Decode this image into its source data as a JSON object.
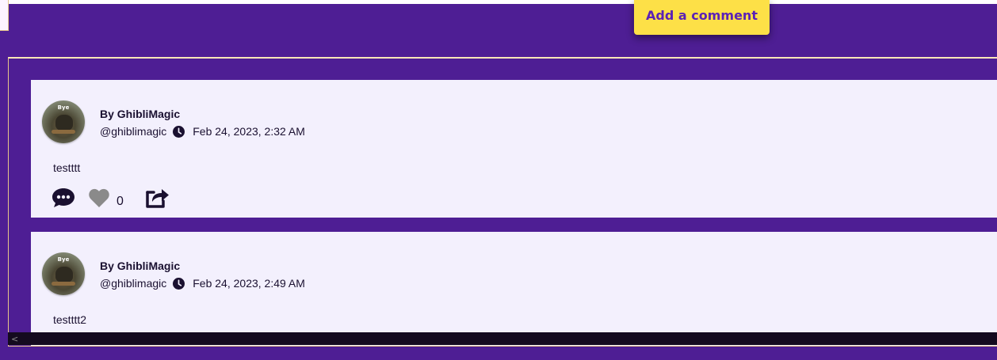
{
  "header": {
    "add_comment_label": "Add a comment"
  },
  "comments": [
    {
      "author": "By GhibliMagic",
      "handle": "@ghiblimagic",
      "timestamp": "Feb 24, 2023, 2:32 AM",
      "text": "testttt",
      "likes": "0",
      "avatar_text": "Bye"
    },
    {
      "author": "By GhibliMagic",
      "handle": "@ghiblimagic",
      "timestamp": "Feb 24, 2023, 2:49 AM",
      "text": "testttt2",
      "avatar_text": "Bye"
    }
  ],
  "icons": {
    "reply": "comment-dots-icon",
    "like": "heart-icon",
    "share": "share-icon",
    "clock": "clock-icon"
  },
  "colors": {
    "background": "#4e1e94",
    "card": "#f3f0fd",
    "button": "#fde047",
    "button_text": "#5b21b6",
    "like_gray": "#8a8a8a"
  }
}
